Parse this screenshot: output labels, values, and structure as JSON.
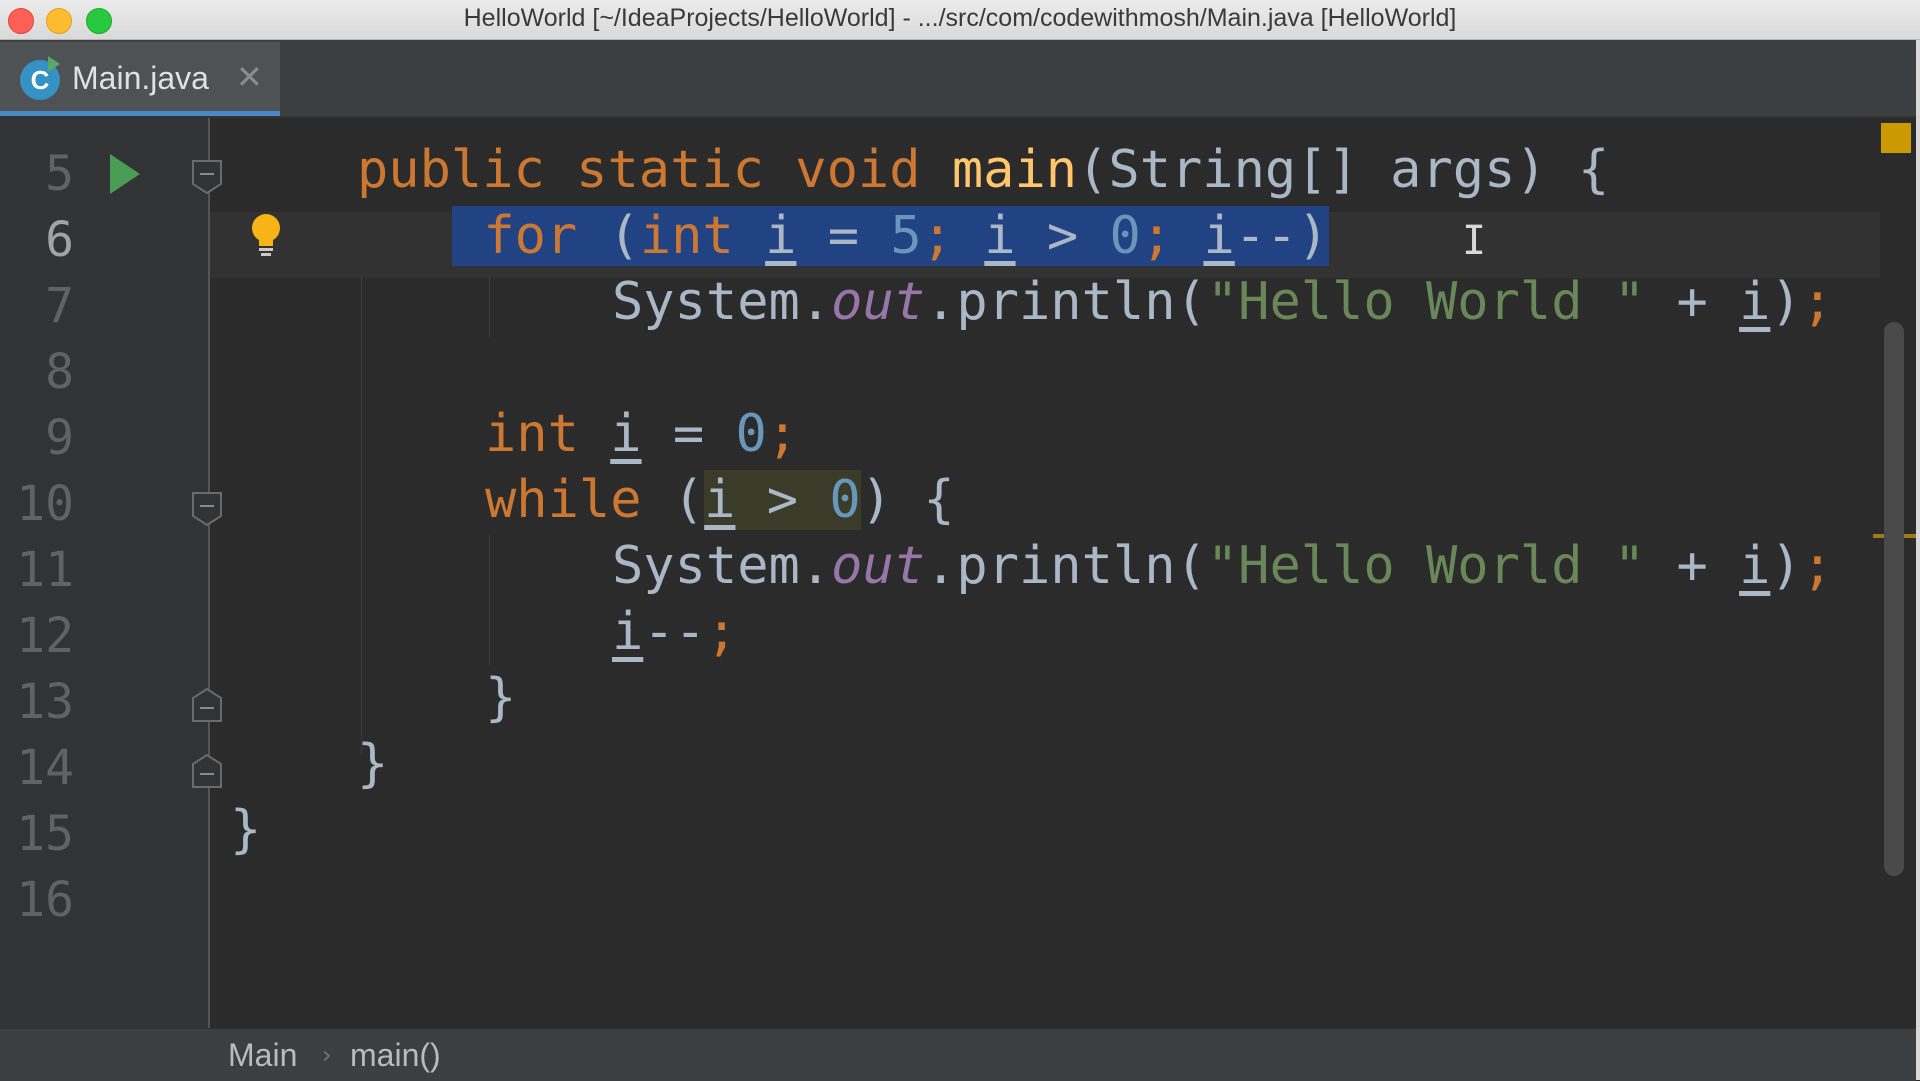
{
  "window": {
    "title": "HelloWorld [~/IdeaProjects/HelloWorld] - .../src/com/codewithmosh/Main.java [HelloWorld]"
  },
  "tab": {
    "label": "Main.java",
    "icon_letter": "C",
    "close_glyph": "✕"
  },
  "gutter": {
    "line_numbers": [
      "5",
      "6",
      "7",
      "8",
      "9",
      "10",
      "11",
      "12",
      "13",
      "14",
      "15",
      "16"
    ],
    "current_line": "6"
  },
  "code": {
    "line5": {
      "kw": "public static void",
      "fn": "main",
      "rest": "(String[] args) {"
    },
    "line6": {
      "kw_for": "for",
      "open": " (",
      "kw_int": "int",
      "var1": "i",
      "eq": " = ",
      "num1": "5",
      "semi1": ";",
      "var2": "i",
      "gt": " > ",
      "num2": "0",
      "semi2": ";",
      "var3": "i",
      "dec": "--)"
    },
    "line7": {
      "obj": "System.",
      "field": "out",
      "method": ".println(",
      "str": "\"Hello World \"",
      "plus": " + ",
      "var": "i",
      "close": ")",
      "semi": ";"
    },
    "line9": {
      "kw": "int",
      "var": "i",
      "eq": " = ",
      "num": "0",
      "semi": ";"
    },
    "line10": {
      "kw": "while",
      "open": " (",
      "var": "i",
      "gt": " > ",
      "num": "0",
      "close": ") {"
    },
    "line11": {
      "obj": "System.",
      "field": "out",
      "method": ".println(",
      "str": "\"Hello World \"",
      "plus": " + ",
      "var": "i",
      "close": ")",
      "semi": ";"
    },
    "line12": {
      "var": "i",
      "dec": "--",
      "semi": ";"
    },
    "line13": "}",
    "line14": "}",
    "line15": "}"
  },
  "statusbar": {
    "crumbs": [
      "Main",
      "main()"
    ],
    "separator": "›"
  },
  "colors": {
    "keyword": "#cc7832",
    "function": "#ffc66d",
    "number": "#6897bb",
    "string": "#6a8759",
    "field": "#9876aa",
    "selection": "#214283",
    "background": "#2b2b2b"
  },
  "icons": {
    "run": "run-gutter-icon",
    "intention": "lightbulb-icon",
    "fold": "fold-marker-icon",
    "cursor": "text-cursor-icon"
  }
}
